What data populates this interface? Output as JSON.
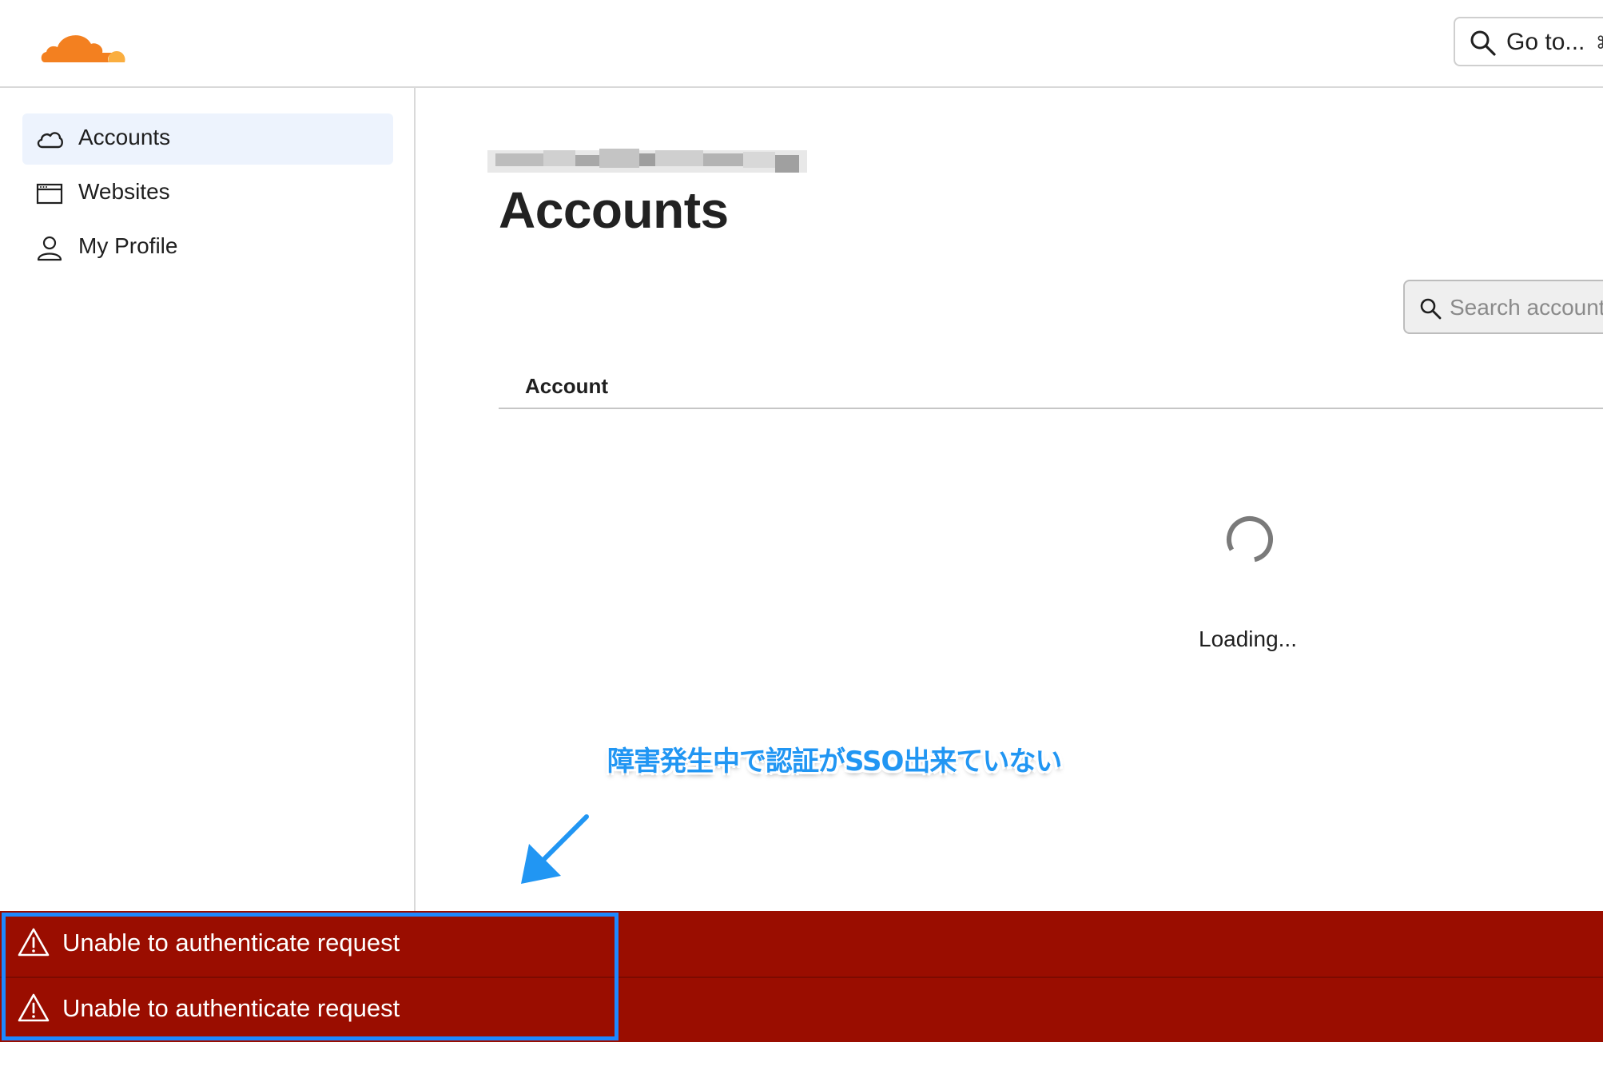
{
  "header": {
    "logo": "cloudflare-logo",
    "goto_label": "Go to...",
    "goto_shortcut": "⌘"
  },
  "sidebar": {
    "items": [
      {
        "label": "Accounts",
        "icon": "cloud-icon",
        "active": true
      },
      {
        "label": "Websites",
        "icon": "browser-window-icon",
        "active": false
      },
      {
        "label": "My Profile",
        "icon": "user-icon",
        "active": false
      }
    ]
  },
  "main": {
    "title": "Accounts",
    "search": {
      "placeholder": "Search accounts"
    },
    "table": {
      "columns": [
        "Account"
      ]
    },
    "loading_text": "Loading..."
  },
  "annotation": {
    "text": "障害発生中で認証がSSO出来ていない",
    "color": "#2196f3"
  },
  "errors": [
    {
      "message": "Unable to authenticate request"
    },
    {
      "message": "Unable to authenticate request"
    }
  ],
  "colors": {
    "brand_orange": "#f38020",
    "brand_orange_light": "#faae40",
    "error_bg": "#9a0d00",
    "active_nav_bg": "#edf3fd",
    "highlight_border": "#1e88ff"
  }
}
